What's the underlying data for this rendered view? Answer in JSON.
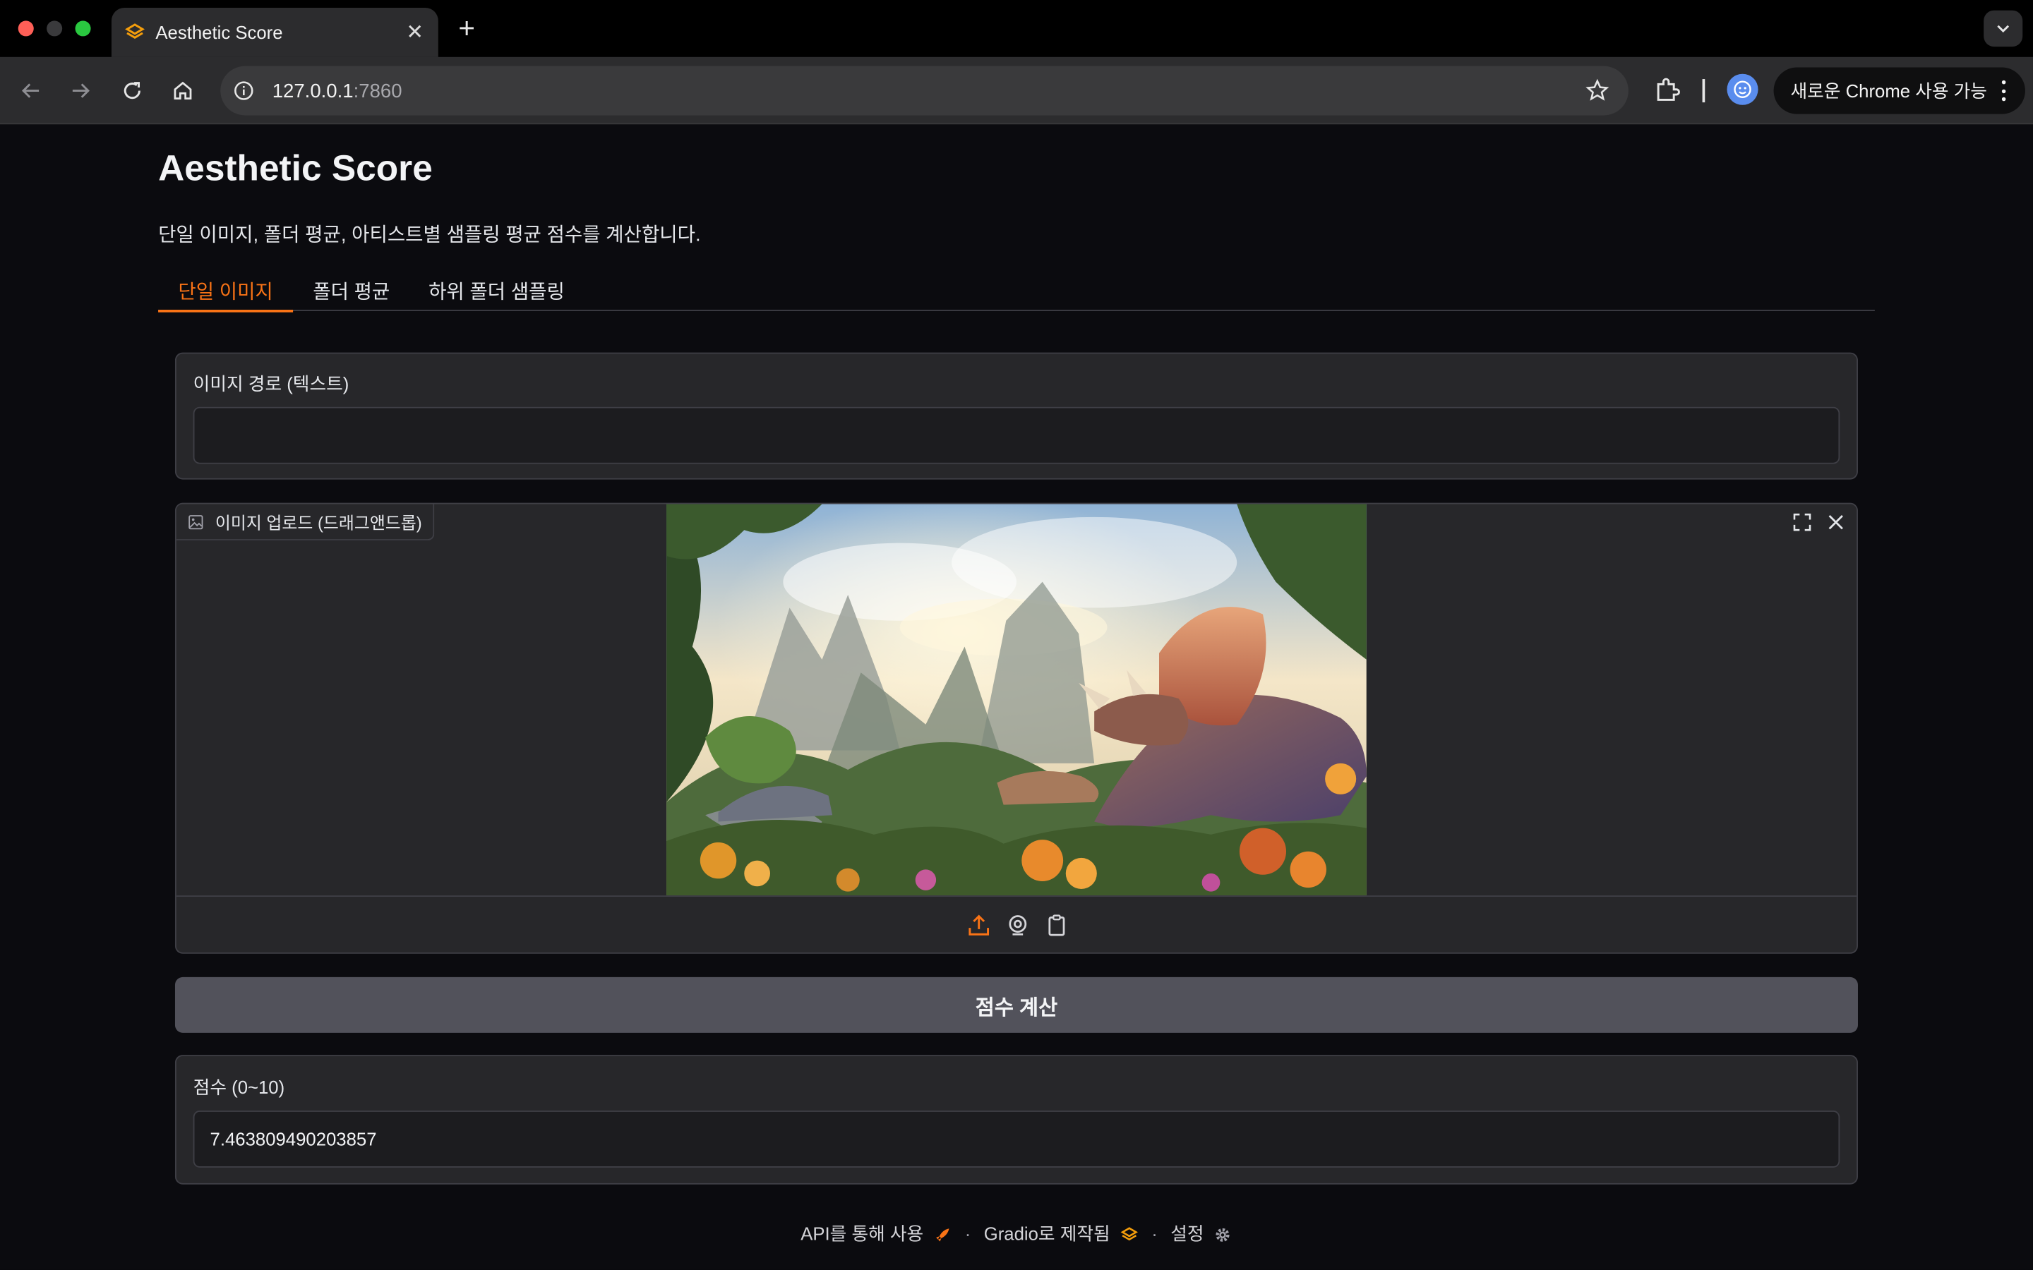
{
  "browser": {
    "tab_title": "Aesthetic Score",
    "url_host": "127.0.0.1",
    "url_port": ":7860",
    "update_pill": "새로운 Chrome 사용 가능"
  },
  "app": {
    "title": "Aesthetic Score",
    "description": "단일 이미지, 폴더 평균, 아티스트별 샘플링 평균 점수를 계산합니다.",
    "tabs": [
      {
        "label": "단일 이미지",
        "active": true
      },
      {
        "label": "폴더 평균",
        "active": false
      },
      {
        "label": "하위 폴더 샘플링",
        "active": false
      }
    ],
    "path_field": {
      "label": "이미지 경로 (텍스트)",
      "value": ""
    },
    "upload": {
      "label": "이미지 업로드 (드래그앤드롭)"
    },
    "submit_label": "점수 계산",
    "score": {
      "label": "점수 (0~10)",
      "value": "7.463809490203857"
    }
  },
  "footer": {
    "api": "API를 통해 사용",
    "built": "Gradio로 제작됨",
    "settings": "설정",
    "separator": "·"
  },
  "colors": {
    "accent": "#f97316",
    "background": "#0b0b0f",
    "panel": "#27272a",
    "button": "#52525b"
  },
  "icons": [
    "gradio-logo-icon",
    "close-icon",
    "plus-icon",
    "back-icon",
    "forward-icon",
    "reload-icon",
    "home-icon",
    "info-icon",
    "star-icon",
    "extensions-icon",
    "profile-icon",
    "more-icon",
    "image-icon",
    "fullscreen-icon",
    "upload-icon",
    "webcam-icon",
    "clipboard-icon",
    "rocket-icon",
    "gear-icon"
  ]
}
